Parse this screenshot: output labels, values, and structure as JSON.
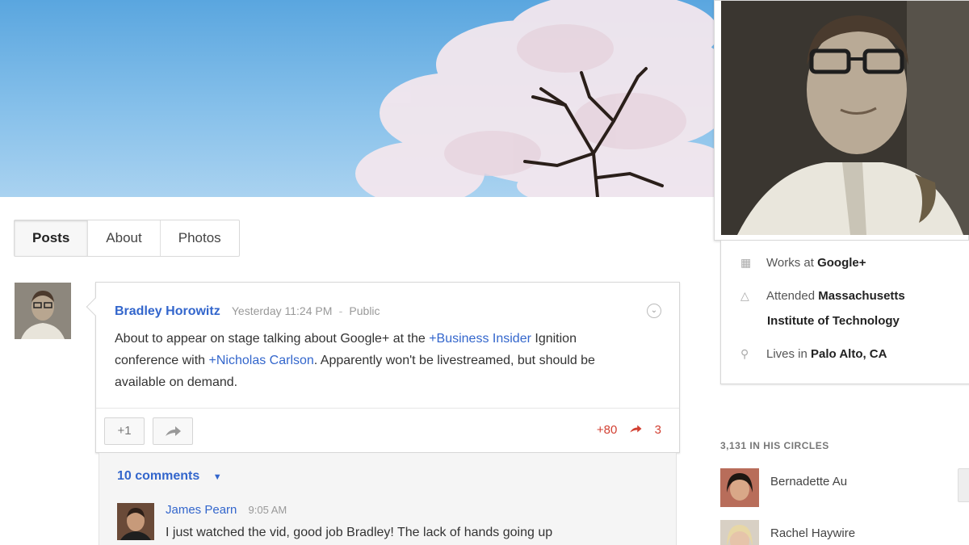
{
  "tabs": [
    {
      "label": "Posts",
      "active": true
    },
    {
      "label": "About",
      "active": false
    },
    {
      "label": "Photos",
      "active": false
    }
  ],
  "post": {
    "author": "Bradley Horowitz",
    "time": "Yesterday 11:24 PM",
    "separator": "-",
    "visibility": "Public",
    "body": {
      "part1": "About to appear on stage talking about Google+ at the ",
      "mention1": "+Business Insider",
      "part2": " Ignition conference with ",
      "mention2": "+Nicholas Carlson",
      "part3": ".  Apparently won't be livestreamed, but should be available on demand."
    },
    "plus_one_label": "+1",
    "share_icon": "share-icon",
    "plus_count": "+80",
    "share_count": "3"
  },
  "comments": {
    "toggle_label": "10 comments",
    "items": [
      {
        "author": "James Pearn",
        "time": "9:05 AM",
        "text": "I just watched the vid, good job Bradley! The lack of hands going up"
      }
    ]
  },
  "about": {
    "work_prefix": "Works at ",
    "work_value": "Google+",
    "school_prefix": "Attended ",
    "school_value_line1": "Massachusetts",
    "school_value_line2": "Institute of Technology",
    "home_prefix": "Lives in ",
    "home_value": "Palo Alto, CA"
  },
  "circles": {
    "title": "3,131 IN HIS CIRCLES",
    "people": [
      {
        "name": "Bernadette Au"
      },
      {
        "name": "Rachel Haywire"
      }
    ]
  },
  "colors": {
    "link": "#3366cc",
    "plus": "#d23f31",
    "sky": "#5aa6df"
  }
}
